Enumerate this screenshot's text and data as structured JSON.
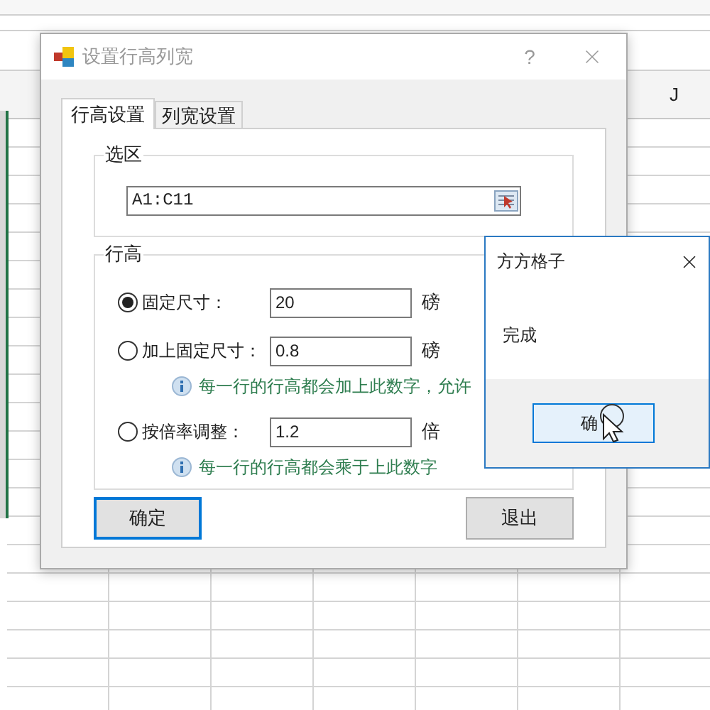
{
  "sheet": {
    "column_header": "J"
  },
  "dialog": {
    "title": "设置行高列宽",
    "help_label": "?",
    "tabs": [
      {
        "label": "行高设置",
        "selected": true
      },
      {
        "label": "列宽设置",
        "selected": false
      }
    ],
    "selection_group": {
      "title": "选区",
      "value": "A1:C11"
    },
    "row_height_group": {
      "title": "行高",
      "options": [
        {
          "label": "固定尺寸：",
          "value": "20",
          "unit": "磅",
          "selected": true
        },
        {
          "label": "加上固定尺寸：",
          "value": "0.8",
          "unit": "磅",
          "selected": false,
          "hint": "每一行的行高都会加上此数字，允许"
        },
        {
          "label": "按倍率调整：",
          "value": "1.2",
          "unit": "倍",
          "selected": false,
          "hint": "每一行的行高都会乘于上此数字"
        }
      ]
    },
    "buttons": [
      {
        "label": "确定",
        "focused": true
      },
      {
        "label": "退出",
        "focused": false
      }
    ]
  },
  "message_box": {
    "title": "方方格子",
    "message": "完成",
    "button": "确"
  }
}
